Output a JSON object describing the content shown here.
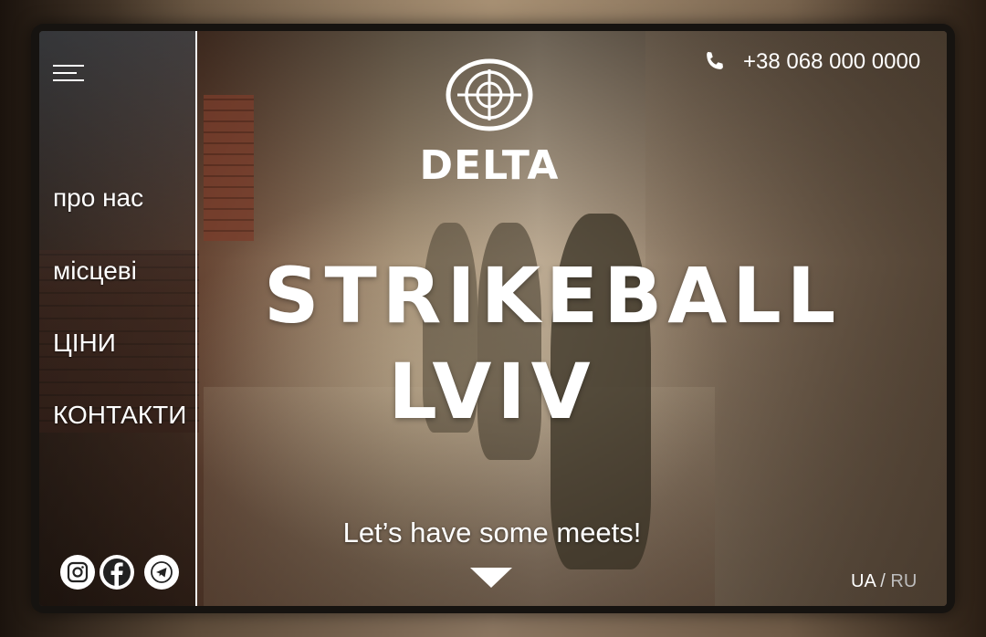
{
  "header": {
    "phone": "+38 068 000 0000",
    "phone_icon": "phone-icon",
    "logo_text": "DELTA",
    "logo_icon": "crosshair-icon"
  },
  "sidebar": {
    "menu_icon": "hamburger-icon",
    "items": [
      {
        "label": "про нас"
      },
      {
        "label": "місцеві"
      },
      {
        "label": "ЦІНИ"
      },
      {
        "label": "КОНТАКТИ"
      }
    ],
    "social": [
      {
        "icon": "instagram-icon"
      },
      {
        "icon": "facebook-icon"
      },
      {
        "icon": "telegram-icon"
      }
    ]
  },
  "hero": {
    "title_line1": "STRIKEBALL",
    "title_line2": "LVIV",
    "tagline": "Let’s have some meets!",
    "scroll_icon": "chevron-down-icon"
  },
  "language": {
    "ua": "UA",
    "separator": "/",
    "ru": "RU",
    "active_color": "#ffffff",
    "inactive_color": "#bdbdbd"
  }
}
